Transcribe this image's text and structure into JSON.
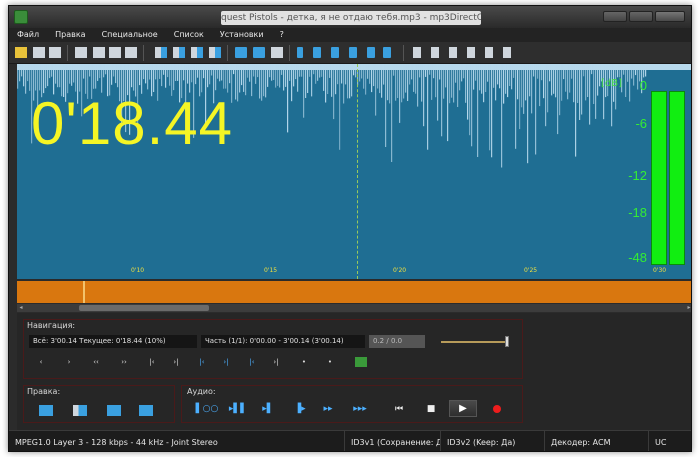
{
  "window": {
    "title": "quest Pistols - детка, я не отдаю тебя.mp3 - mp3DirectCut"
  },
  "menu": [
    "Файл",
    "Правка",
    "Специальное",
    "Список",
    "Установки",
    "?"
  ],
  "waveform": {
    "time_display": "0'18.44",
    "db_unit": "[dB]",
    "db_labels": [
      "0",
      "-6",
      "-12",
      "-18",
      "-48"
    ],
    "ticks": [
      "0'10",
      "0'15",
      "0'20",
      "0'25",
      "0'30"
    ],
    "colors": {
      "background": "#1f6e93",
      "peaks": "#b7d9ec",
      "time": "#f5f525",
      "meter": "#11ee11"
    }
  },
  "navigation": {
    "label": "Навигация:",
    "total_info": "Всё: 3'00.14   Текущее: 0'18.44   (10%)",
    "part_info": "Часть (1/1): 0'00.00 - 3'00.14 (3'00.14)",
    "counter": "0.2 / 0.0",
    "buttons": [
      "‹",
      "›",
      "‹‹",
      "››",
      "|‹",
      "›|",
      "|‹",
      "›|",
      "|‹",
      "›|",
      "•",
      "•"
    ]
  },
  "edit": {
    "label": "Правка:"
  },
  "audio": {
    "label": "Аудио:",
    "buttons": [
      "▌○○",
      "▸▌▌",
      "▸▌",
      "▐▸",
      "▸▸",
      "▸▸▸"
    ],
    "transport": {
      "prev": "⏮",
      "stop": "■",
      "play": "▶"
    }
  },
  "status": {
    "format": "MPEG1.0 Layer 3 - 128 kbps - 44 kHz - Joint Stereo",
    "id3v1": "ID3v1 (Сохранение: Да)",
    "id3v2": "ID3v2 (Keep: Да)",
    "decoder": "Декодер: ACM",
    "uc": "UC"
  }
}
